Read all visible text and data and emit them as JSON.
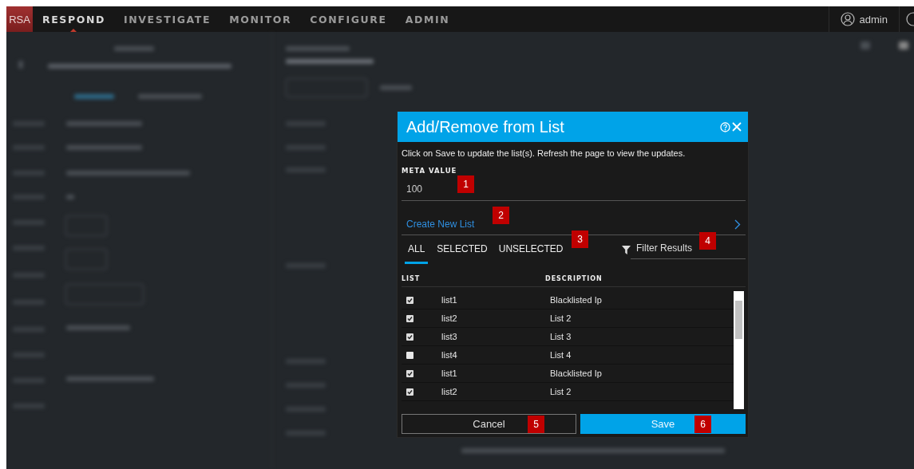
{
  "nav": {
    "logo": "RSA",
    "items": [
      {
        "label": "RESPOND",
        "selected": true
      },
      {
        "label": "INVESTIGATE",
        "selected": false
      },
      {
        "label": "MONITOR",
        "selected": false
      },
      {
        "label": "CONFIGURE",
        "selected": false
      },
      {
        "label": "ADMIN",
        "selected": false
      }
    ],
    "user": "admin"
  },
  "dialog": {
    "title": "Add/Remove from List",
    "description": "Click on Save to update the list(s). Refresh the page to view the updates.",
    "meta_value": {
      "label": "META VALUE",
      "value": "100"
    },
    "create_link": "Create New List",
    "tabs": [
      {
        "label": "ALL",
        "selected": true
      },
      {
        "label": "SELECTED",
        "selected": false
      },
      {
        "label": "UNSELECTED",
        "selected": false
      }
    ],
    "filter": {
      "placeholder": "Filter Results"
    },
    "columns": [
      "LIST",
      "DESCRIPTION"
    ],
    "rows": [
      {
        "checked": true,
        "list": "list1",
        "description": "Blacklisted Ip"
      },
      {
        "checked": true,
        "list": "list2",
        "description": "List 2"
      },
      {
        "checked": true,
        "list": "list3",
        "description": "List 3"
      },
      {
        "checked": false,
        "list": "list4",
        "description": "List 4"
      },
      {
        "checked": true,
        "list": "list1",
        "description": "Blacklisted Ip"
      },
      {
        "checked": true,
        "list": "list2",
        "description": "List 2"
      }
    ],
    "buttons": [
      {
        "kind": "secondary",
        "label": "Cancel"
      },
      {
        "kind": "primary",
        "label": "Save"
      }
    ]
  },
  "callouts": [
    "1",
    "2",
    "3",
    "4",
    "5",
    "6"
  ]
}
